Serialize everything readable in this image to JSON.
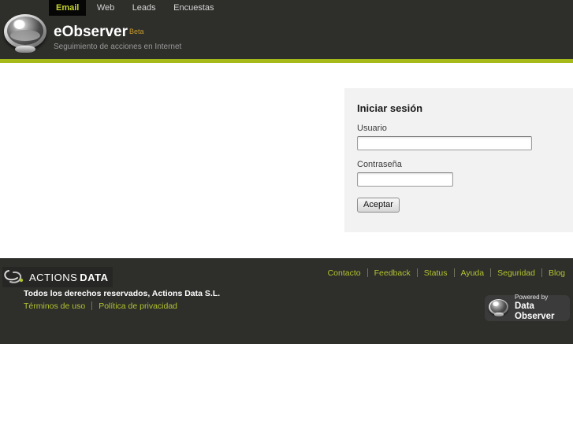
{
  "header": {
    "tabs": [
      {
        "label": "Email",
        "active": true
      },
      {
        "label": "Web",
        "active": false
      },
      {
        "label": "Leads",
        "active": false
      },
      {
        "label": "Encuestas",
        "active": false
      }
    ],
    "brand": {
      "name": "eObserver",
      "badge": "Beta",
      "tagline": "Seguimiento de acciones en Internet"
    }
  },
  "login": {
    "title": "Iniciar sesión",
    "username_label": "Usuario",
    "username_value": "",
    "password_label": "Contraseña",
    "password_value": "",
    "submit_label": "Aceptar"
  },
  "footer": {
    "logo": {
      "part1": "ACTIONS",
      "part2": "DATA"
    },
    "nav_links": [
      "Contacto",
      "Feedback",
      "Status",
      "Ayuda",
      "Seguridad",
      "Blog"
    ],
    "copyright": "Todos los derechos reservados, Actions Data S.L.",
    "legal_links": [
      "Términos de uso",
      "Política de privacidad"
    ],
    "powered_by": {
      "line1": "Powered by",
      "line2": "Data Observer"
    }
  },
  "icons": {
    "eobserver_logo": "glossy-sphere-orb",
    "actions_data_logo": "orbit-swirl-with-green-dot",
    "powered_by_logo": "glossy-sphere-orb-small"
  },
  "colors": {
    "header_bg": "#2e2e2b",
    "active_tab_bg": "#060606",
    "active_tab_text": "#c6d42f",
    "accent_bar": "#a5ba19",
    "beta_badge": "#c79c2d",
    "panel_bg": "#f2f2f2",
    "footer_bg": "#2e2e2b",
    "link_green": "#b2c32e",
    "badge_bg": "#3b3b3b"
  }
}
